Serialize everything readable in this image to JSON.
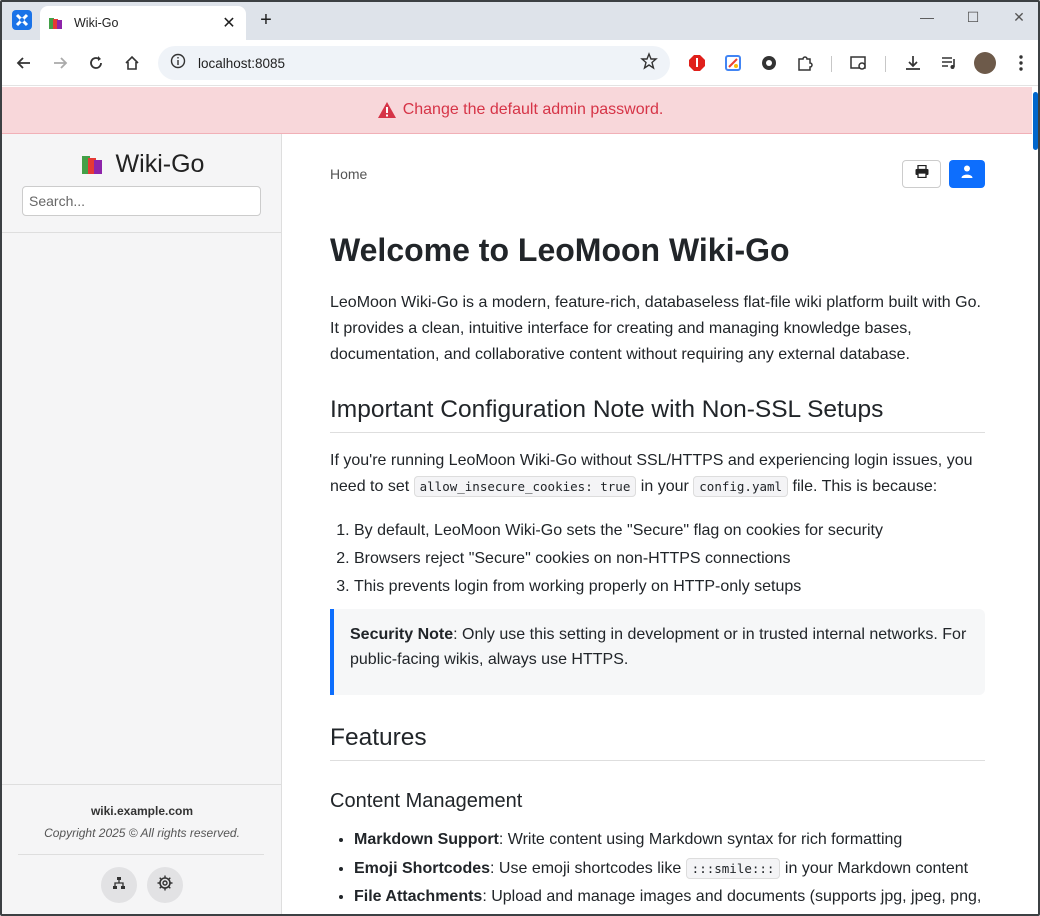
{
  "browser": {
    "tab_title": "Wiki-Go",
    "url": "localhost:8085"
  },
  "alert": {
    "text": "Change the default admin password.",
    "color": "#d63447",
    "background": "#f8d7da"
  },
  "sidebar": {
    "brand": "Wiki-Go",
    "search_placeholder": "Search...",
    "domain": "wiki.example.com",
    "copyright": "Copyright 2025 © All rights reserved."
  },
  "content": {
    "breadcrumb": "Home",
    "title": "Welcome to LeoMoon Wiki-Go",
    "intro": "LeoMoon Wiki-Go is a modern, feature-rich, databaseless flat-file wiki platform built with Go. It provides a clean, intuitive interface for creating and managing knowledge bases, documentation, and collaborative content without requiring any external database.",
    "config_heading": "Important Configuration Note with Non-SSL Setups",
    "config_p_1": "If you're running LeoMoon Wiki-Go without SSL/HTTPS and experiencing login issues, you need to set ",
    "config_code_1": "allow_insecure_cookies: true",
    "config_p_2": " in your ",
    "config_code_2": "config.yaml",
    "config_p_3": " file. This is because:",
    "reasons": [
      "By default, LeoMoon Wiki-Go sets the \"Secure\" flag on cookies for security",
      "Browsers reject \"Secure\" cookies on non-HTTPS connections",
      "This prevents login from working properly on HTTP-only setups"
    ],
    "note_label": "Security Note",
    "note_text": ": Only use this setting in development or in trusted internal networks. For public-facing wikis, always use HTTPS.",
    "features_heading": "Features",
    "content_mgmt_heading": "Content Management",
    "features": [
      {
        "label": "Markdown Support",
        "text": ": Write content using Markdown syntax for rich formatting"
      },
      {
        "label": "Emoji Shortcodes",
        "text": ": Use emoji shortcodes like ",
        "code": ":::smile:::",
        "text2": " in your Markdown content"
      },
      {
        "label": "File Attachments",
        "text": ": Upload and manage images and documents (supports jpg, jpeg, png,"
      }
    ]
  },
  "colors": {
    "accent": "#0d6efd",
    "sidebar_bg": "#f5f5f6"
  }
}
